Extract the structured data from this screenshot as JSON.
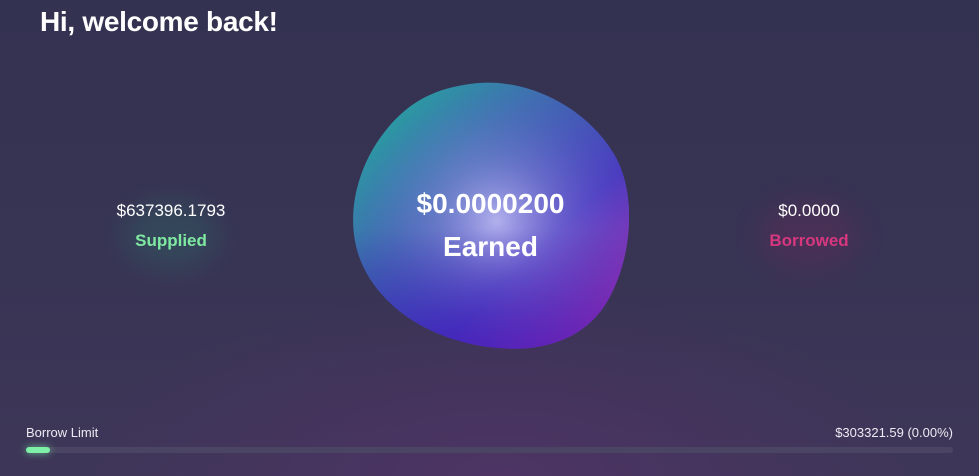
{
  "header": {
    "greeting": "Hi, welcome back!"
  },
  "stats": {
    "supplied": {
      "value": "$637396.1793",
      "label": "Supplied"
    },
    "earned": {
      "value": "$0.0000200",
      "label": "Earned"
    },
    "borrowed": {
      "value": "$0.0000",
      "label": "Borrowed"
    }
  },
  "borrow_limit": {
    "label": "Borrow Limit",
    "value_text": "$303321.59 (0.00%)",
    "used_fraction": 0.0
  },
  "colors": {
    "supplied": "#7fe9a2",
    "borrowed": "#d6377f",
    "background": "#363352",
    "progress_fill": "#7ef0a8",
    "progress_track": "#4a4563"
  },
  "icons": {
    "center": "gradient-blob"
  }
}
